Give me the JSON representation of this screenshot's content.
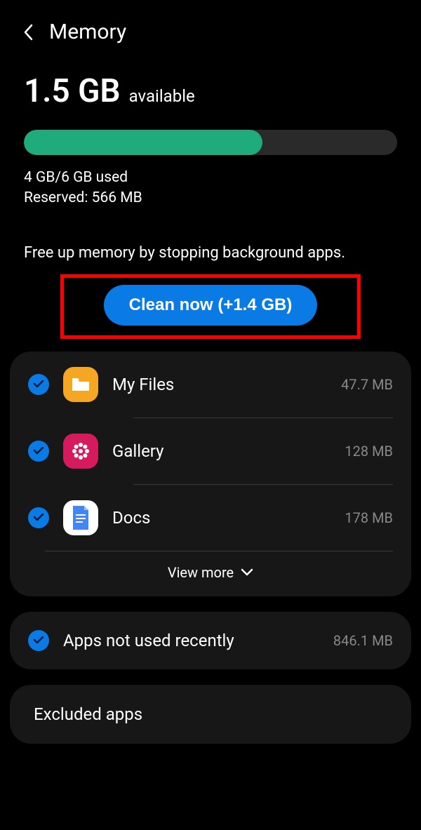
{
  "header": {
    "title": "Memory"
  },
  "memory": {
    "available_value": "1.5 GB",
    "available_label": "available",
    "used_text": "4 GB/6 GB used",
    "reserved_text": "Reserved: 566 MB",
    "progress_percent": 64
  },
  "instruction": "Free up memory by stopping background apps.",
  "clean_button_label": "Clean now (+1.4 GB)",
  "apps": [
    {
      "name": "My Files",
      "size": "47.7 MB"
    },
    {
      "name": "Gallery",
      "size": "128 MB"
    },
    {
      "name": "Docs",
      "size": "178 MB"
    }
  ],
  "view_more_label": "View more",
  "recent": {
    "title": "Apps not used recently",
    "size": "846.1 MB"
  },
  "excluded": {
    "title": "Excluded apps"
  }
}
